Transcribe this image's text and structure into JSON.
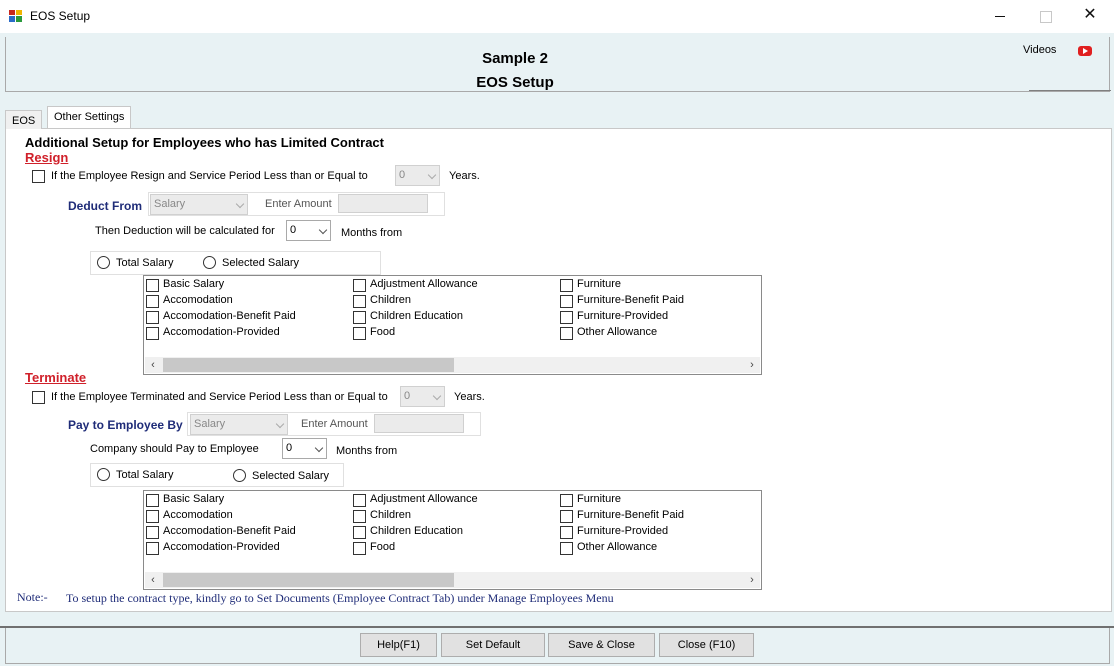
{
  "window": {
    "title": "EOS Setup",
    "videos_label": "Videos"
  },
  "header": {
    "line1": "Sample 2",
    "line2": "EOS Setup"
  },
  "tabs": [
    {
      "label": "EOS"
    },
    {
      "label": "Other Settings"
    }
  ],
  "heading": "Additional Setup for Employees who has Limited Contract",
  "resign": {
    "title": "Resign",
    "condition_label": "If the Employee Resign and Service Period Less than or Equal to",
    "years_value": "0",
    "years_label": "Years.",
    "deduct_label": "Deduct From",
    "deduct_value": "Salary",
    "enter_amount_label": "Enter Amount",
    "months_prefix": "Then Deduction will be calculated for",
    "months_value": "0",
    "months_suffix": "Months from",
    "radio_total": "Total Salary",
    "radio_selected": "Selected Salary"
  },
  "terminate": {
    "title": "Terminate",
    "condition_label": "If the Employee Terminated and Service Period Less than or Equal to",
    "years_value": "0",
    "years_label": "Years.",
    "pay_label": "Pay to Employee By",
    "pay_value": "Salary",
    "enter_amount_label": "Enter Amount",
    "months_prefix": "Company should Pay to Employee",
    "months_value": "0",
    "months_suffix": "Months from",
    "radio_total": "Total Salary",
    "radio_selected": "Selected Salary"
  },
  "allowances": {
    "col1": [
      "Basic Salary",
      "Accomodation",
      "Accomodation-Benefit Paid",
      "Accomodation-Provided"
    ],
    "col2": [
      "Adjustment Allowance",
      "Children",
      "Children Education",
      "Food"
    ],
    "col3": [
      "Furniture",
      "Furniture-Benefit Paid",
      "Furniture-Provided",
      "Other Allowance"
    ]
  },
  "note": {
    "label": "Note:-",
    "text": "To setup the contract type, kindly go to Set Documents (Employee Contract Tab)  under Manage Employees Menu"
  },
  "buttons": {
    "help": "Help(F1)",
    "set_default": "Set Default",
    "save_close": "Save & Close",
    "close": "Close (F10)"
  },
  "scroll": {
    "left_arrow": "‹",
    "right_arrow": "›"
  },
  "glyphs": {
    "close": "✕"
  },
  "colors": {
    "section_title": "#d0202a",
    "navy": "#1f2c78",
    "frame_bg": "#e8f2f4"
  }
}
